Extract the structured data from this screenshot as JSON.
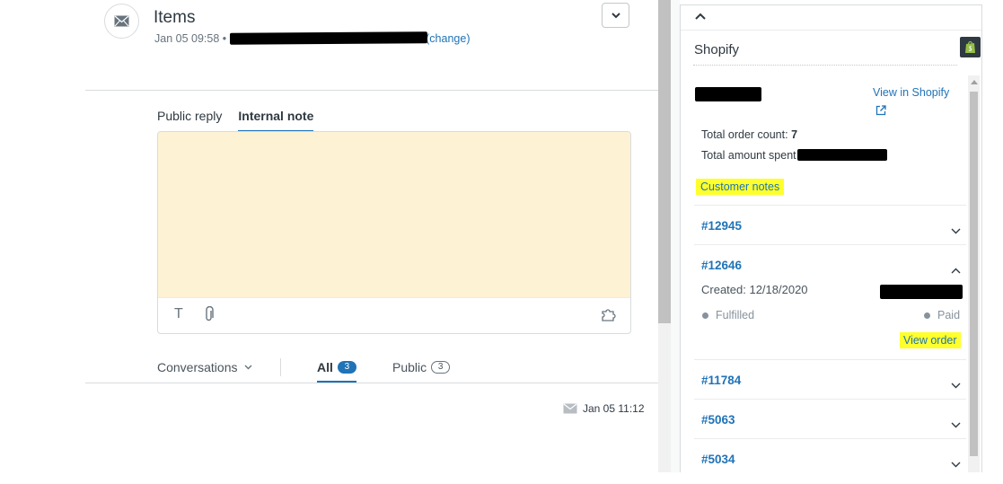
{
  "ticket": {
    "title": "Items",
    "date": "Jan 05 09:58 •",
    "change_link": "(change)",
    "menu_icon": "chevron-down-icon",
    "avatar_icon": "envelope-icon"
  },
  "reply": {
    "tabs": [
      {
        "label": "Public reply",
        "active": false
      },
      {
        "label": "Internal note",
        "active": true
      }
    ],
    "toolbar": {
      "text_format_glyph": "T",
      "attach_icon": "paperclip-icon",
      "apps_icon": "puzzle-icon"
    },
    "note_color": "#fdf2d3"
  },
  "conversations": {
    "label": "Conversations",
    "tabs": [
      {
        "label": "All",
        "count": "3",
        "active": true
      },
      {
        "label": "Public",
        "count": "3",
        "active": false
      }
    ]
  },
  "message": {
    "time": "Jan 05 11:12",
    "channel_icon": "envelope-icon"
  },
  "shopify": {
    "title": "Shopify",
    "view_in_shopify": "View in Shopify",
    "total_order_label": "Total order count:",
    "total_order_value": "7",
    "total_spent_label": "Total amount spent",
    "customer_notes": "Customer notes",
    "orders": [
      {
        "id": "#12945",
        "expanded": false
      },
      {
        "id": "#12646",
        "expanded": true
      },
      {
        "id": "#11784",
        "expanded": false
      },
      {
        "id": "#5063",
        "expanded": false
      },
      {
        "id": "#5034",
        "expanded": false
      }
    ],
    "expanded_order": {
      "created": "Created: 12/18/2020",
      "fulfillment": "Fulfilled",
      "payment": "Paid",
      "view_order": "View order"
    },
    "highlight_color": "#ffff2b",
    "link_color": "#1f73b7"
  }
}
